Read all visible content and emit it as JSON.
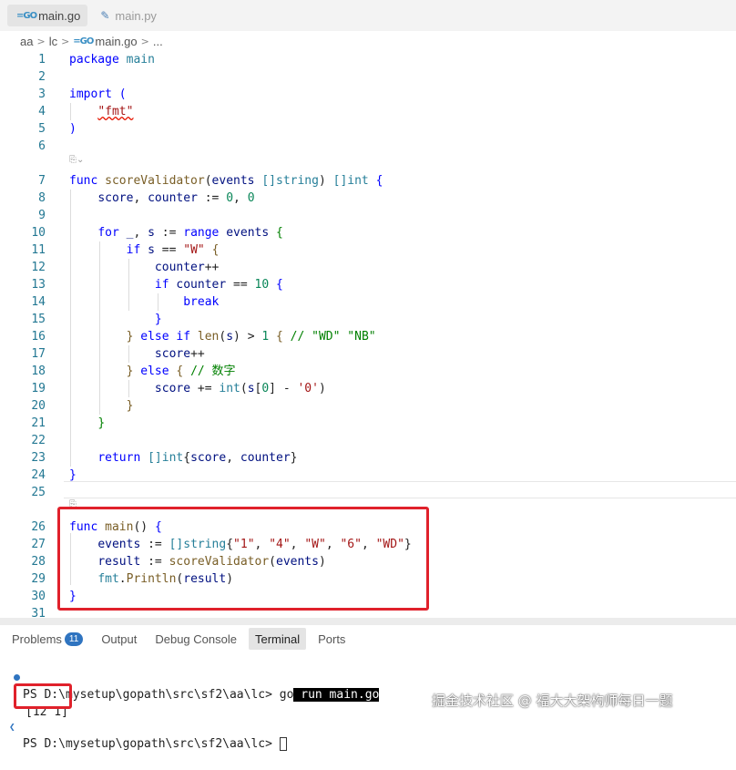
{
  "tabs": [
    {
      "icon": "go-icon",
      "label": "main.go",
      "active": true
    },
    {
      "icon": "python-icon",
      "label": "main.py",
      "active": false
    }
  ],
  "breadcrumb": {
    "folder1": "aa",
    "folder2": "lc",
    "file": "main.go",
    "more": "..."
  },
  "code_lines": [
    {
      "n": "1",
      "html": "<span class=\"kw\">package</span> <span class=\"fmtpkg\">main</span>"
    },
    {
      "n": "2",
      "html": ""
    },
    {
      "n": "3",
      "html": "<span class=\"kw\">import</span> <span class=\"kw\">(</span>"
    },
    {
      "n": "4",
      "html": "    <span class=\"str squig\">\"fmt\"</span>"
    },
    {
      "n": "5",
      "html": "<span class=\"kw\">)</span>"
    },
    {
      "n": "6",
      "html": ""
    },
    {
      "n": "7",
      "html": "<span class=\"kw\">func</span> <span class=\"fn\">scoreValidator</span>(<span class=\"var\">events</span> <span class=\"typ\">[]string</span>) <span class=\"typ\">[]int</span> <span class=\"kw\">{</span>"
    },
    {
      "n": "8",
      "html": "    <span class=\"var\">score</span>, <span class=\"var\">counter</span> := <span class=\"num\">0</span>, <span class=\"num\">0</span>"
    },
    {
      "n": "9",
      "html": ""
    },
    {
      "n": "10",
      "html": "    <span class=\"kw\">for</span> <span class=\"var\">_</span>, <span class=\"var\">s</span> := <span class=\"kw\">range</span> <span class=\"var\">events</span> <span class=\"cmt\">{</span>"
    },
    {
      "n": "11",
      "html": "        <span class=\"kw\">if</span> <span class=\"var\">s</span> == <span class=\"str\">\"W\"</span> <span class=\"fn\">{</span>"
    },
    {
      "n": "12",
      "html": "            <span class=\"var\">counter</span>++"
    },
    {
      "n": "13",
      "html": "            <span class=\"kw\">if</span> <span class=\"var\">counter</span> == <span class=\"num\">10</span> <span class=\"kw\">{</span>"
    },
    {
      "n": "14",
      "html": "                <span class=\"kw\">break</span>"
    },
    {
      "n": "15",
      "html": "            <span class=\"kw\">}</span>"
    },
    {
      "n": "16",
      "html": "        <span class=\"fn\">}</span> <span class=\"kw\">else if</span> <span class=\"fn\">len</span>(<span class=\"var\">s</span>) &gt; <span class=\"num\">1</span> <span class=\"fn\">{</span> <span class=\"cmt\">// \"WD\" \"NB\"</span>"
    },
    {
      "n": "17",
      "html": "            <span class=\"var\">score</span>++"
    },
    {
      "n": "18",
      "html": "        <span class=\"fn\">}</span> <span class=\"kw\">else</span> <span class=\"fn\">{</span> <span class=\"cmt\">// 数字</span>"
    },
    {
      "n": "19",
      "html": "            <span class=\"var\">score</span> += <span class=\"typ\">int</span>(<span class=\"var\">s</span>[<span class=\"num\">0</span>] - <span class=\"str\">'0'</span>)"
    },
    {
      "n": "20",
      "html": "        <span class=\"fn\">}</span>"
    },
    {
      "n": "21",
      "html": "    <span class=\"cmt\">}</span>"
    },
    {
      "n": "22",
      "html": ""
    },
    {
      "n": "23",
      "html": "    <span class=\"kw\">return</span> <span class=\"typ\">[]int</span>{<span class=\"var\">score</span>, <span class=\"var\">counter</span>}"
    },
    {
      "n": "24",
      "html": "<span class=\"kw\">}</span>"
    },
    {
      "n": "25",
      "html": ""
    },
    {
      "n": "26",
      "html": "<span class=\"kw\">func</span> <span class=\"fn\">main</span>() <span class=\"kw\">{</span>"
    },
    {
      "n": "27",
      "html": "    <span class=\"var\">events</span> := <span class=\"typ\">[]string</span>{<span class=\"str\">\"1\"</span>, <span class=\"str\">\"4\"</span>, <span class=\"str\">\"W\"</span>, <span class=\"str\">\"6\"</span>, <span class=\"str\">\"WD\"</span>}"
    },
    {
      "n": "28",
      "html": "    <span class=\"var\">result</span> := <span class=\"fn\">scoreValidator</span>(<span class=\"var\">events</span>)"
    },
    {
      "n": "29",
      "html": "    <span class=\"fmtpkg\">fmt</span>.<span class=\"fn\">Println</span>(<span class=\"var\">result</span>)"
    },
    {
      "n": "30",
      "html": "<span class=\"kw\">}</span>"
    },
    {
      "n": "31",
      "html": ""
    }
  ],
  "panel_tabs": [
    {
      "label": "Problems",
      "badge": "11",
      "active": false
    },
    {
      "label": "Output",
      "active": false
    },
    {
      "label": "Debug Console",
      "active": false
    },
    {
      "label": "Terminal",
      "active": true
    },
    {
      "label": "Ports",
      "active": false
    }
  ],
  "terminal": {
    "line1_prompt": "PS D:\\mysetup\\gopath\\src\\sf2\\aa\\lc> ",
    "line1_cmd_plain": "go",
    "line1_cmd_selected": " run main.go",
    "line2_output": "[12 1]",
    "line3_prompt": "PS D:\\mysetup\\gopath\\src\\sf2\\aa\\lc> "
  },
  "watermark": "掘金技术社区 @ 福大大架构师每日一题",
  "colors": {
    "highlight_box": "#e0212b",
    "badge": "#2f74c0"
  }
}
